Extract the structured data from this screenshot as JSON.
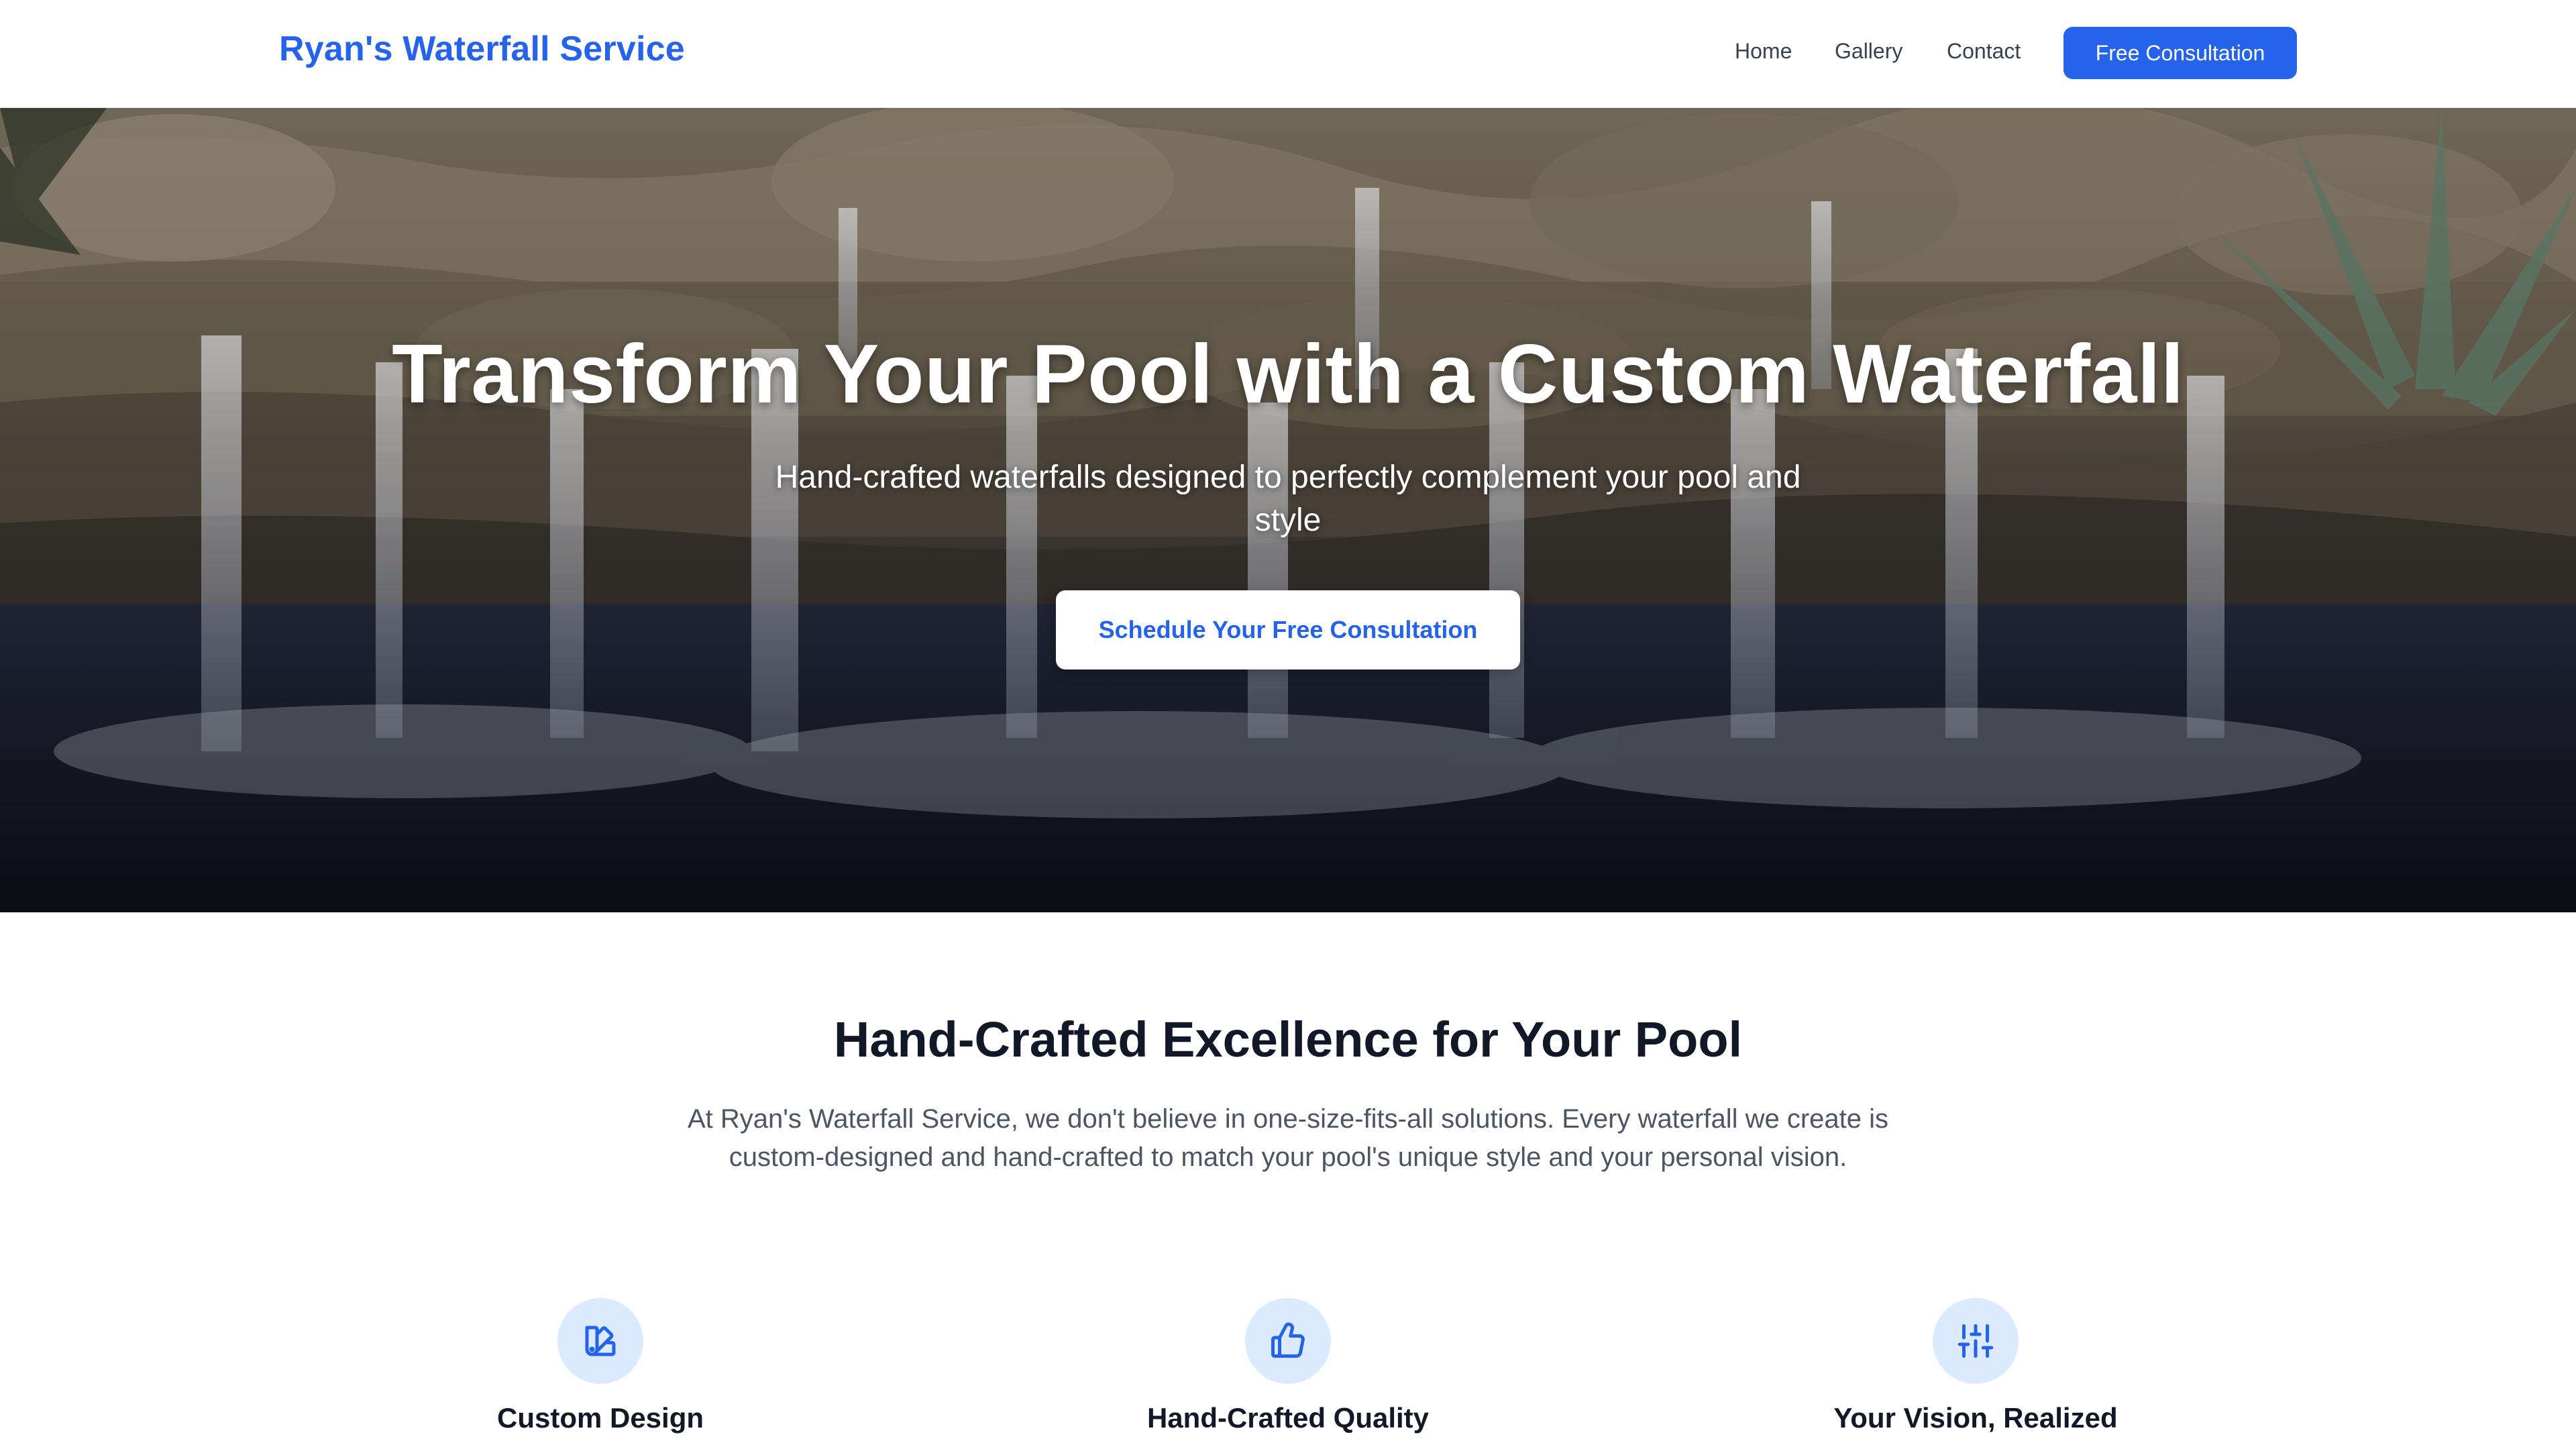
{
  "header": {
    "brand": "Ryan's Waterfall Service",
    "nav": {
      "home": "Home",
      "gallery": "Gallery",
      "contact": "Contact"
    },
    "cta": "Free Consultation"
  },
  "hero": {
    "image_icon": "waterfall-photo",
    "title": "Transform Your Pool with a Custom Waterfall",
    "subtitle": "Hand-crafted waterfalls designed to perfectly complement your pool and style",
    "cta": "Schedule Your Free Consultation"
  },
  "about": {
    "title": "Hand-Crafted Excellence for Your Pool",
    "text": "At Ryan's Waterfall Service, we don't believe in one-size-fits-all solutions. Every waterfall we create is custom-designed and hand-crafted to match your pool's unique style and your personal vision."
  },
  "features": [
    {
      "icon": "swatch-icon",
      "title": "Custom Design"
    },
    {
      "icon": "thumbs-up-icon",
      "title": "Hand-Crafted Quality"
    },
    {
      "icon": "sliders-icon",
      "title": "Your Vision, Realized"
    }
  ],
  "colors": {
    "accent": "#2563eb",
    "icon_bg": "#dbeafe",
    "heading": "#111827",
    "body_text": "#4b5563"
  }
}
